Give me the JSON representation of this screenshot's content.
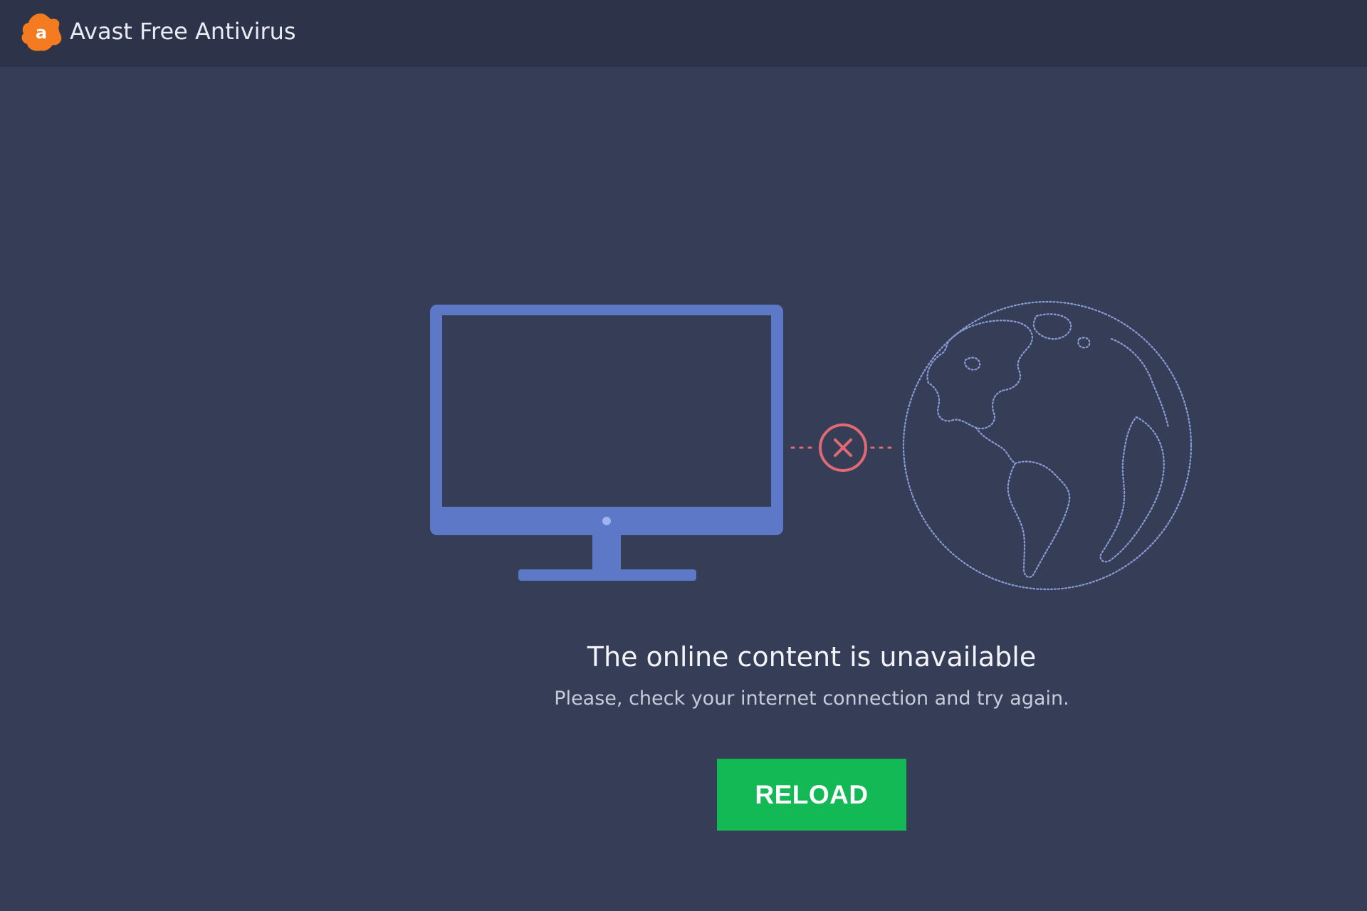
{
  "window": {
    "title": "Avast Free Antivirus",
    "logo_icon": "avast-logo-icon"
  },
  "illustration": {
    "icons": [
      "monitor-icon",
      "disconnected-x-icon",
      "globe-icon"
    ],
    "monitor_color": "#5d78c6",
    "error_color": "#e06a73",
    "globe_color": "#8a9bd4"
  },
  "message": {
    "heading": "The online content is unavailable",
    "subtext": "Please, check your internet connection and try again."
  },
  "actions": {
    "reload_label": "RELOAD"
  },
  "colors": {
    "background": "#363e57",
    "titlebar": "#2d344a",
    "accent_orange": "#f47b20",
    "button_green": "#12b955"
  }
}
